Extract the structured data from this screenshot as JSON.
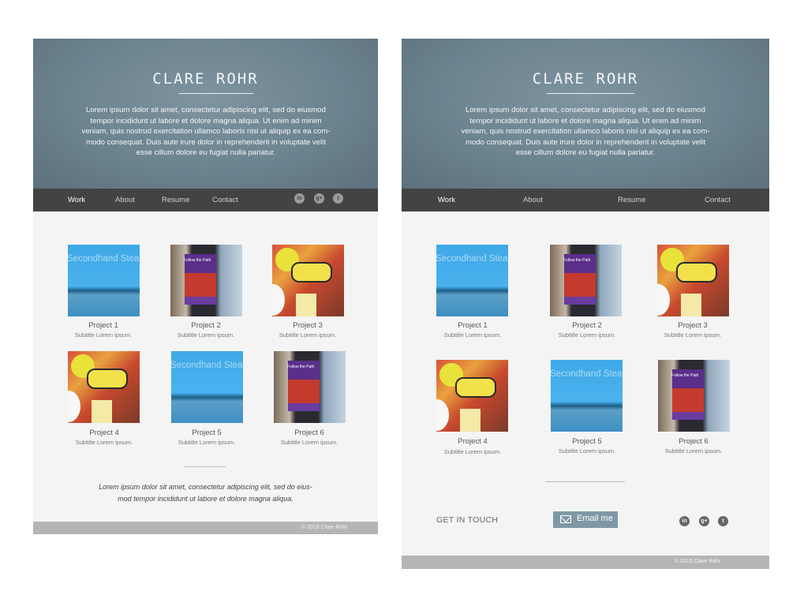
{
  "site": {
    "name": "CLARE ROHR",
    "bio": "Lorem ipsum dolor sit amet, consectetur adipiscing elit, sed do eiusmod tempor incididunt ut labore et dolore magna aliqua. Ut enim ad minim veniam, quis nostrud exercitation ullamco laboris nisi ut aliquip ex ea com-modo consequat. Duis aute irure dolor in reprehenderit in voluptate velit esse cillum dolore eu fugiat nulla pariatur.",
    "bio_lines": [
      "Lorem ipsum dolor sit amet, consectetur adipiscing elit, sed do eiusmod",
      "tempor incididunt ut labore et dolore magna aliqua. Ut enim ad minim",
      "veniam, quis nostrud exercitation ullamco laboris nisi ut aliquip ex ea com-",
      "modo consequat. Duis aute irure dolor in reprehenderit in voluptate velit",
      "esse cillum dolore eu fugiat nulla pariatur."
    ]
  },
  "nav": {
    "items": [
      {
        "label": "Work",
        "active": true
      },
      {
        "label": "About"
      },
      {
        "label": "Resume"
      },
      {
        "label": "Contact"
      }
    ],
    "social": [
      {
        "icon": "linkedin-icon",
        "glyph": "in"
      },
      {
        "icon": "google-plus-icon",
        "glyph": "g+"
      },
      {
        "icon": "twitter-icon",
        "glyph": "t"
      }
    ]
  },
  "tile_labels": {
    "secondhand": "Secondhand Steal",
    "follow": "Follow the Path"
  },
  "projects": [
    {
      "title": "Project 1",
      "subtitle": "Subtitle Lorem ipsum.",
      "image": "secondhand"
    },
    {
      "title": "Project 2",
      "subtitle": "Subtitle Lorem ipsum.",
      "image": "phone"
    },
    {
      "title": "Project 3",
      "subtitle": "Subtitle Lorem ipsum.",
      "image": "kid"
    },
    {
      "title": "Project 4",
      "subtitle": "Subtitle Lorem ipsum.",
      "image": "kid"
    },
    {
      "title": "Project 5",
      "subtitle": "Subtitle Lorem ipsum.",
      "image": "secondhand"
    },
    {
      "title": "Project 6",
      "subtitle": "Subtitle Lorem ipsum.",
      "image": "phone"
    }
  ],
  "quote_lines": [
    "Lorem ipsum dolor sit amet, consectetur adipiscing elit, sed do eius-",
    "mod tempor incididunt ut labore et dolore magna aliqua."
  ],
  "contact": {
    "heading": "GET IN TOUCH",
    "email_label": "Email me"
  },
  "footer": {
    "copyright": "© 2015 Clare Rohr"
  },
  "colors": {
    "hero": "#6c8390",
    "nav": "#434343",
    "page": "#f4f4f4",
    "footer": "#b5b5b5",
    "email_button": "#7f98a5"
  }
}
